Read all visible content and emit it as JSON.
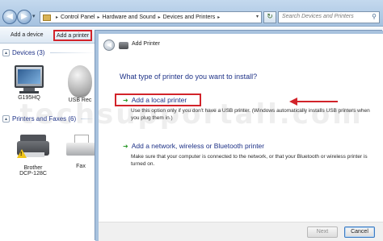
{
  "explorer": {
    "breadcrumb": [
      "Control Panel",
      "Hardware and Sound",
      "Devices and Printers"
    ],
    "search_placeholder": "Search Devices and Printers",
    "toolbar": {
      "add_device": "Add a device",
      "add_printer": "Add a printer"
    },
    "groups": {
      "devices": {
        "header": "Devices (3)",
        "items": [
          {
            "label": "G195HQ",
            "icon": "monitor-icon"
          },
          {
            "label": "USB Rec",
            "icon": "mouse-icon"
          }
        ]
      },
      "printers": {
        "header": "Printers and Faxes (6)",
        "items": [
          {
            "label_line1": "Brother",
            "label_line2": "DCP-128C",
            "icon": "printer-icon",
            "warning": true
          },
          {
            "label": "Fax",
            "icon": "fax-icon"
          }
        ]
      }
    }
  },
  "wizard": {
    "title": "Add Printer",
    "heading": "What type of printer do you want to install?",
    "options": [
      {
        "label": "Add a local printer",
        "description": "Use this option only if you don't have a USB printer. (Windows automatically installs USB printers when you plug them in.)"
      },
      {
        "label": "Add a network, wireless or Bluetooth printer",
        "description": "Make sure that your computer is connected to the network, or that your Bluetooth or wireless printer is turned on."
      }
    ],
    "buttons": {
      "next": "Next",
      "cancel": "Cancel"
    }
  },
  "watermark": "techsupportall.com",
  "colors": {
    "highlight_red": "#d2232a",
    "link_blue": "#1e3287",
    "arrow_green": "#2c9a2c"
  }
}
